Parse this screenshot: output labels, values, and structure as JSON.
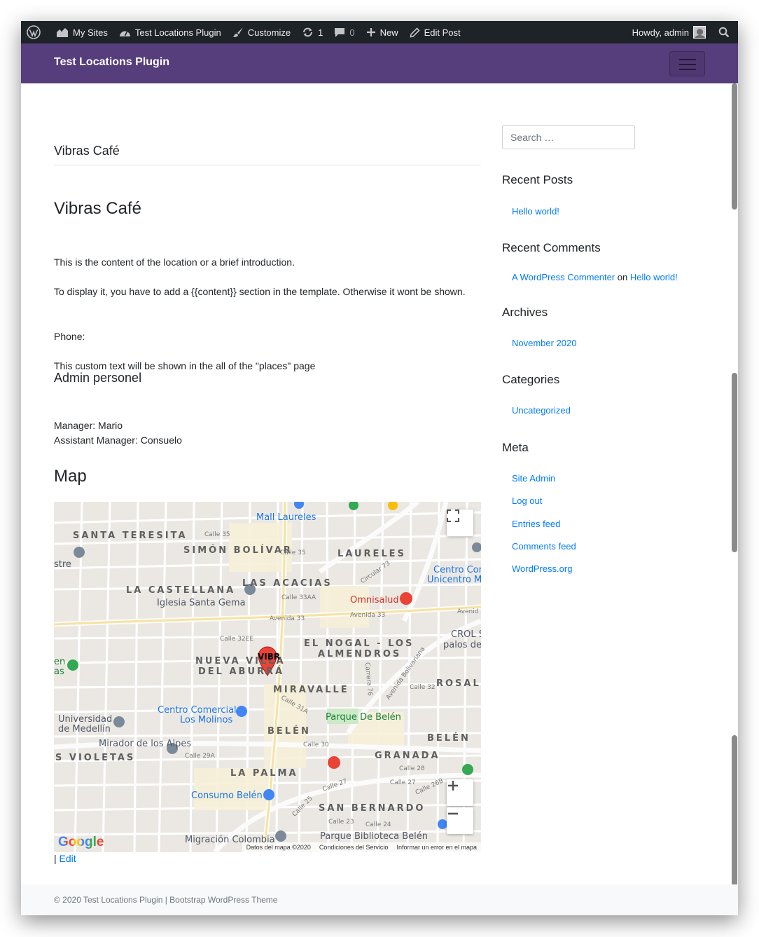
{
  "adminbar": {
    "my_sites": "My Sites",
    "site_name": "Test Locations Plugin",
    "customize": "Customize",
    "updates_count": "1",
    "comments_count": "0",
    "new": "New",
    "edit_post": "Edit Post",
    "howdy": "Howdy, admin"
  },
  "header": {
    "brand": "Test Locations Plugin"
  },
  "main": {
    "page_title": "Vibras Café",
    "entry_title": "Vibras Café",
    "intro": "This is the content of the location or a brief introduction.",
    "template_note": "To display it, you have to add a {{content}} section in the template. Otherwise it wont be shown.",
    "phone": "Phone:",
    "custom_text": "This custom text will be shown in the all of the \"places\" page",
    "admin_heading": "Admin personel",
    "manager": "Manager: Mario",
    "assistant_manager": "Assistant Manager: Consuelo",
    "map_heading": "Map",
    "edit_prefix": "|",
    "edit_link": "Edit"
  },
  "map": {
    "marker_label": "VIBR",
    "areas": {
      "santa_teresita": "SANTA TERESITA",
      "simon_bolivar": "SIMÓN BOLÍVAR",
      "laureles": "LAURELES",
      "la_castellana": "LA CASTELLANA",
      "las_acacias": "LAS ACACIAS",
      "el_nogal": "EL NOGAL - LOS",
      "almendros": "ALMENDROS",
      "nueva_villa": "NUEVA VILLA",
      "del_abura": "DEL ABURRÁ",
      "miravalle": "MIRAVALLE",
      "rosal": "ROSAL",
      "belen": "BELÉN",
      "belen_2": "BELÉN",
      "granada": "GRANADA",
      "violetas": "S VIOLETAS",
      "la_palma": "LA PALMA",
      "san_bernardo": "SAN BERNARDO",
      "crol": "CROL S",
      "palos": "palos de"
    },
    "pois": {
      "mall_laureles": "Mall Laureles",
      "centro_com": "Centro Com",
      "unicentro": "Unicentro M",
      "omnisalud": "Omnisalud",
      "iglesia": "Iglesia Santa Gema",
      "centro_comercial": "Centro Comercial",
      "los_molinos": "Los Molinos",
      "parque_belen": "Parque De Belén",
      "universidad": "Universidad",
      "de_medellin": "de Medellín",
      "mirador": "Mirador de los Alpes",
      "consumo": "Consumo Belén",
      "migracion": "Migración Colombia",
      "parque_biblioteca": "Parque Biblioteca Belén",
      "stre": "stre",
      "en": "en",
      "as": "as"
    },
    "streets": {
      "calle35": "Calle 35",
      "avenida33": "Avenida 33",
      "avenida33b": "Avenida 33",
      "calle30": "Calle 30",
      "calle27": "Calle 27",
      "calle27b": "Calle 27",
      "calle31a": "Calle 31A",
      "carrera76": "Carrera 76",
      "av_bolivariana": "Avenida Bolivariana",
      "avenid": "Avenid",
      "calle32ee": "Calle 32EE",
      "calle33aa": "Calle 33AA",
      "calle29a": "Calle 29A",
      "calle26b": "Calle 26B",
      "calle25": "Calle 25",
      "calle23": "Calle 23",
      "calle24": "Calle 24",
      "calle28": "Calle 28",
      "calle32": "Calle 32",
      "circular73": "Circular 73"
    },
    "google": "Google",
    "footer_data": "Datos del mapa ©2020",
    "footer_terms": "Condiciones del Servicio",
    "footer_report": "Informar un error en el mapa"
  },
  "sidebar": {
    "search_placeholder": "Search …",
    "recent_posts_title": "Recent Posts",
    "recent_posts": [
      "Hello world!"
    ],
    "recent_comments_title": "Recent Comments",
    "comment_author": "A WordPress Commenter",
    "comment_on": "on",
    "comment_post": "Hello world!",
    "archives_title": "Archives",
    "archives": [
      "November 2020"
    ],
    "categories_title": "Categories",
    "categories": [
      "Uncategorized"
    ],
    "meta_title": "Meta",
    "meta": [
      "Site Admin",
      "Log out",
      "Entries feed",
      "Comments feed",
      "WordPress.org"
    ]
  },
  "footer": {
    "text": "© 2020 Test Locations Plugin | Bootstrap WordPress Theme"
  },
  "colors": {
    "adminbar_bg": "#1d2327",
    "header_bg": "#563d7c",
    "link": "#007bff",
    "marker": "#ea4335"
  }
}
